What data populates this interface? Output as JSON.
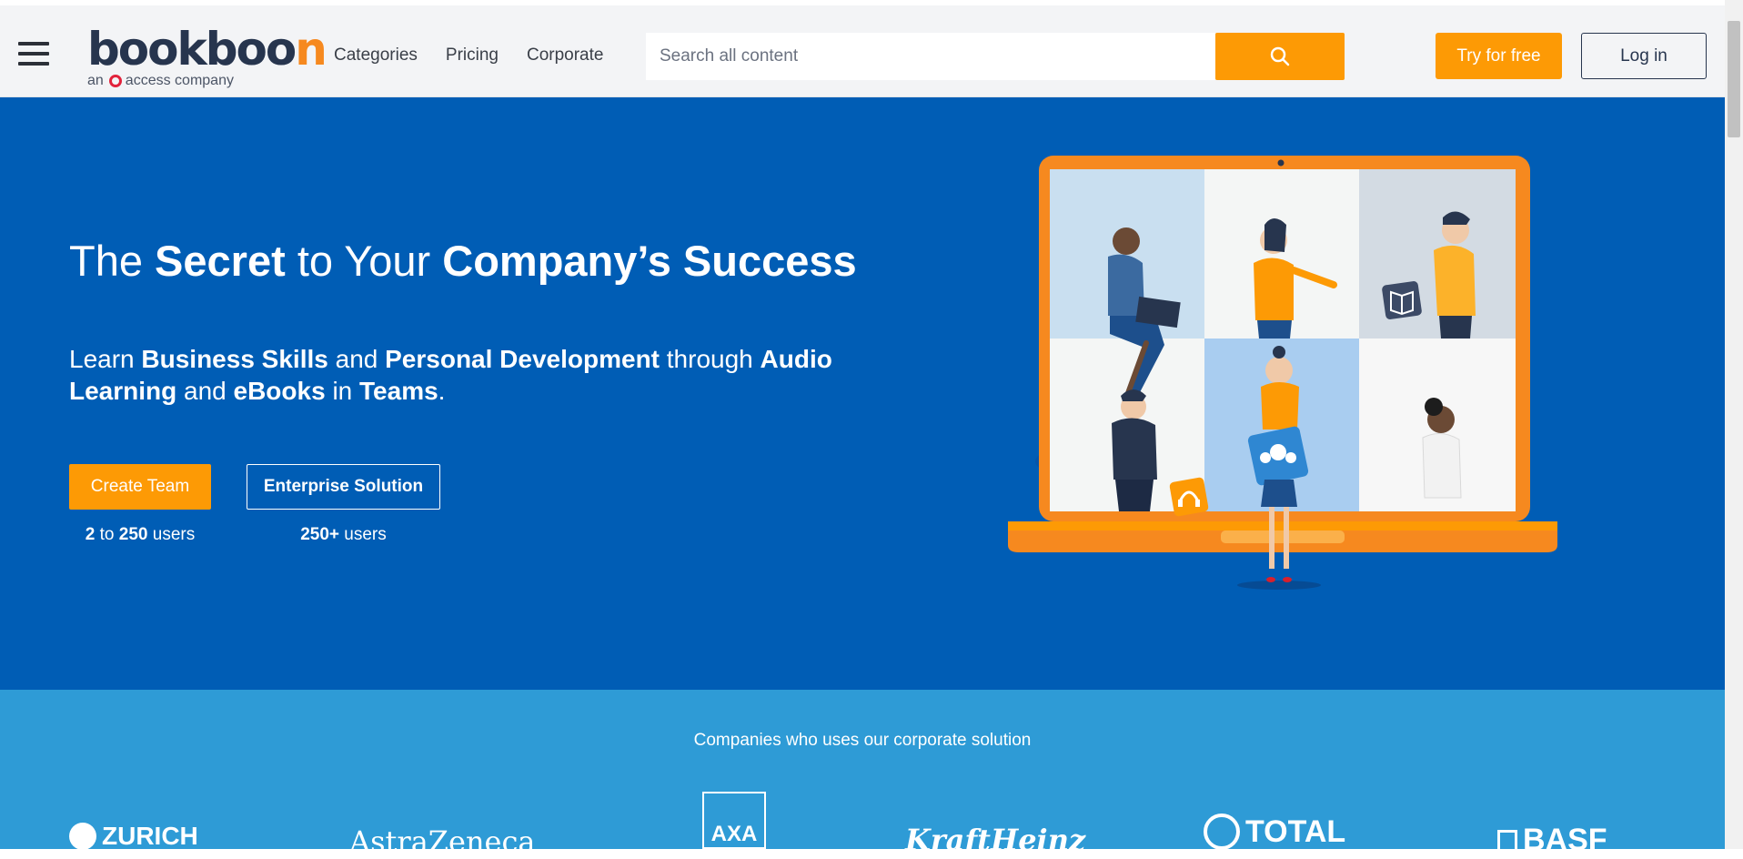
{
  "header": {
    "menu_icon": "hamburger-menu-icon",
    "logo": {
      "brand": "bookboon",
      "tagline_prefix": "an",
      "tagline": "access company"
    },
    "nav": [
      "Categories",
      "Pricing",
      "Corporate"
    ],
    "search": {
      "placeholder": "Search all content",
      "icon": "search-icon"
    },
    "try_free_label": "Try for free",
    "login_label": "Log in"
  },
  "hero": {
    "title": {
      "p1": "The ",
      "b1": "Secret",
      "p2": " to Your ",
      "b2": "Company’s Success"
    },
    "subtitle": {
      "p1": "Learn ",
      "b1": "Business Skills",
      "p2": " and ",
      "b2": "Personal Development",
      "p3": " through ",
      "b3": "Audio Learning",
      "p4": " and ",
      "b4": "eBooks",
      "p5": " in ",
      "b5": "Teams",
      "p6": "."
    },
    "create_team": {
      "label": "Create Team",
      "users_min": "2",
      "users_to": " to ",
      "users_max": "250",
      "users_suffix": " users"
    },
    "enterprise": {
      "label": "Enterprise Solution",
      "users_count": "250+",
      "users_suffix": " users"
    }
  },
  "companies": {
    "heading": "Companies who uses our corporate solution",
    "logos": [
      "ZURICH",
      "AstraZeneca",
      "AXA",
      "KraftHeinz",
      "TOTAL",
      "BASF"
    ]
  },
  "colors": {
    "accent_orange": "#fd9a05",
    "hero_blue": "#005db5",
    "companies_blue": "#2e9bd6",
    "brand_navy": "#27354e",
    "logo_ring_red": "#e2233c"
  }
}
